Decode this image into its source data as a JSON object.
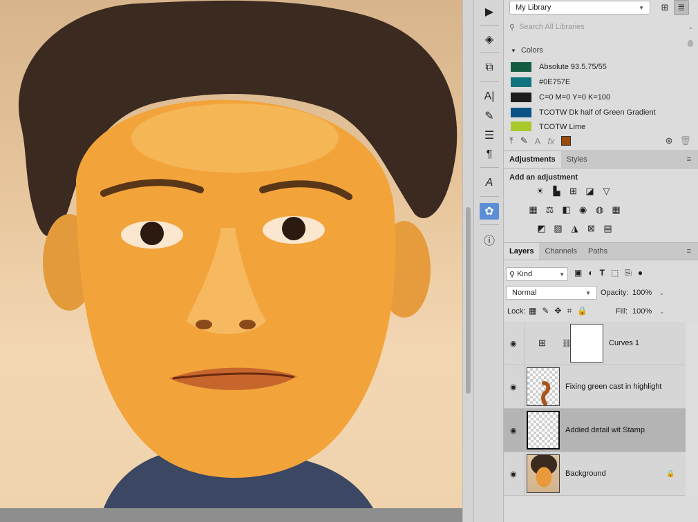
{
  "library": {
    "selected": "My Library",
    "search_placeholder": "Search All Libraries",
    "section_title": "Colors",
    "swatches": [
      {
        "name": "Absolute 93.5.75/55",
        "color": "#125C3F"
      },
      {
        "name": "#0E757E",
        "color": "#0E757E"
      },
      {
        "name": "C=0 M=0 Y=0 K=100",
        "color": "#1C1C1C"
      },
      {
        "name": "TCOTW Dk half of Green Gradient",
        "color": "#0B5385"
      },
      {
        "name": "TCOTW Lime",
        "color": "#A8C82B"
      }
    ],
    "footer_color": "#9C4A0A"
  },
  "adjustments": {
    "tabs": [
      "Adjustments",
      "Styles"
    ],
    "add_label": "Add an adjustment",
    "rows": [
      [
        "brightness-contrast-icon",
        "levels-icon",
        "curves-icon",
        "exposure-icon",
        "vibrance-icon"
      ],
      [
        "hue-saturation-icon",
        "color-balance-icon",
        "black-white-icon",
        "photo-filter-icon",
        "channel-mixer-icon",
        "color-lookup-icon"
      ],
      [
        "invert-icon",
        "posterize-icon",
        "threshold-icon",
        "selective-color-icon",
        "gradient-map-icon"
      ]
    ],
    "glyphs": [
      [
        "☀",
        "▙",
        "⊞",
        "◪",
        "▽"
      ],
      [
        "▦",
        "⚖",
        "◧",
        "◉",
        "◍",
        "▦"
      ],
      [
        "◩",
        "▨",
        "◮",
        "⊠",
        "▤"
      ]
    ]
  },
  "layers": {
    "tabs": [
      "Layers",
      "Channels",
      "Paths"
    ],
    "filter_kind": "Kind",
    "blend_mode": "Normal",
    "opacity_label": "Opacity:",
    "opacity_value": "100%",
    "lock_label": "Lock:",
    "fill_label": "Fill:",
    "fill_value": "100%",
    "items": [
      {
        "name": "Curves 1",
        "type": "adjustment"
      },
      {
        "name": "Fixing green cast in highlight",
        "type": "pixel"
      },
      {
        "name": "Addied detail wit Stamp",
        "type": "pixel",
        "selected": true
      },
      {
        "name": "Background",
        "type": "background",
        "locked": true
      }
    ]
  },
  "toolstrip": {
    "tools": [
      "play-icon",
      "3d-icon",
      "clone-source-icon",
      "character-icon",
      "brush-presets-icon",
      "properties-icon",
      "paragraph-icon",
      "glyphs-icon",
      "libraries-icon",
      "info-icon"
    ]
  }
}
